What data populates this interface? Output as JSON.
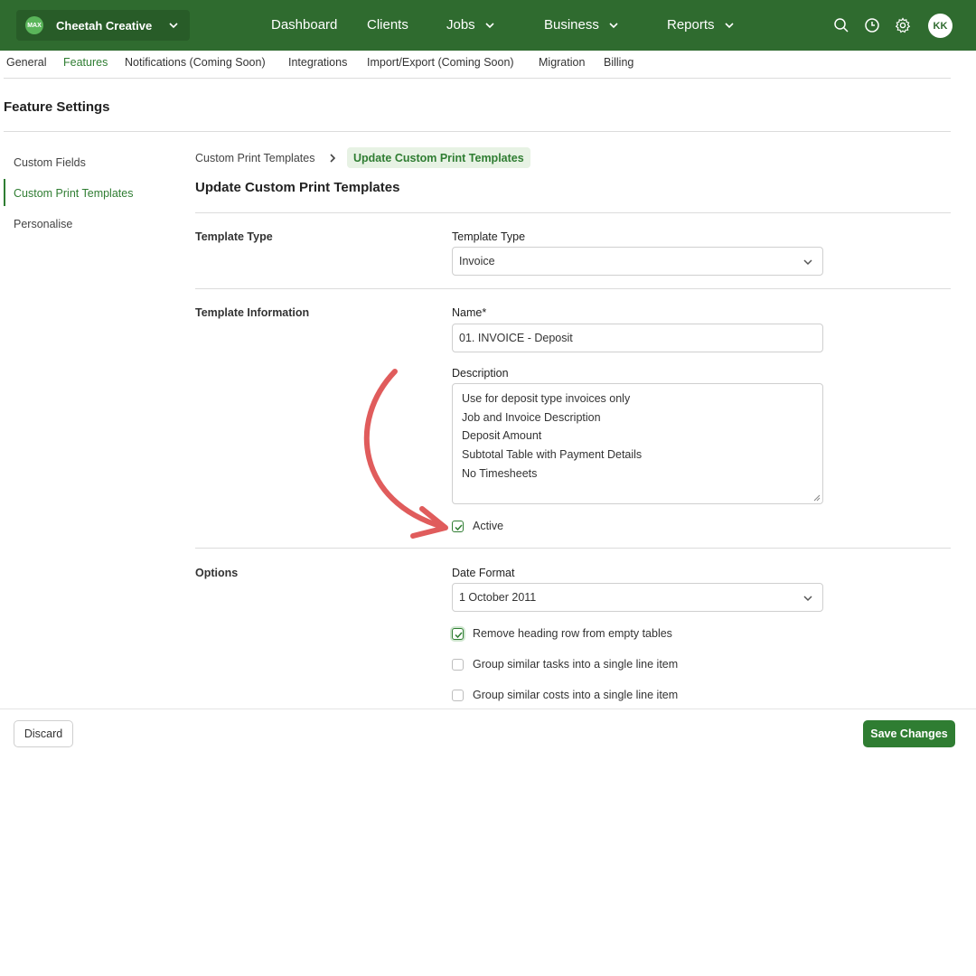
{
  "topbar": {
    "org_badge": "MAX",
    "org_name": "Cheetah Creative (",
    "nav": [
      "Dashboard",
      "Clients",
      "Jobs",
      "Business",
      "Reports"
    ],
    "icons": [
      "search-icon",
      "clock-icon",
      "gear-icon"
    ],
    "avatar": "KK"
  },
  "subnav": [
    "General",
    "Features",
    "Notifications (Coming Soon)",
    "Integrations",
    "Import/Export (Coming Soon)",
    "Migration",
    "Billing"
  ],
  "subnav_active": "Features",
  "page_title": "Feature Settings",
  "side_menu": [
    "Custom Fields",
    "Custom Print Templates",
    "Personalise"
  ],
  "side_menu_active": "Custom Print Templates",
  "breadcrumb": {
    "parent": "Custom Print Templates",
    "current": "Update Custom Print Templates"
  },
  "section_title": "Update Custom Print Templates",
  "template_type": {
    "section": "Template Type",
    "label": "Template Type",
    "value": "Invoice"
  },
  "template_info": {
    "section": "Template Information",
    "name_label": "Name*",
    "name_value": "01. INVOICE - Deposit",
    "description_label": "Description",
    "description_lines": [
      "Use for deposit type invoices only",
      "Job and Invoice Description",
      "Deposit Amount",
      "Subtotal Table with Payment Details",
      "No Timesheets"
    ],
    "active_label": "Active",
    "active_checked": true
  },
  "options": {
    "section": "Options",
    "date_format_label": "Date Format",
    "date_format_value": "1 October 2011",
    "checkboxes": [
      {
        "label": "Remove heading row from empty tables",
        "checked": true
      },
      {
        "label": "Group similar tasks into a single line item",
        "checked": false
      },
      {
        "label": "Group similar costs into a single line item",
        "checked": false
      }
    ]
  },
  "footer": {
    "discard": "Discard",
    "save": "Save Changes"
  },
  "colors": {
    "brand_green": "#2f6b2f",
    "accent_green": "#2f7d32",
    "annotation_arrow": "#e05c5c"
  }
}
